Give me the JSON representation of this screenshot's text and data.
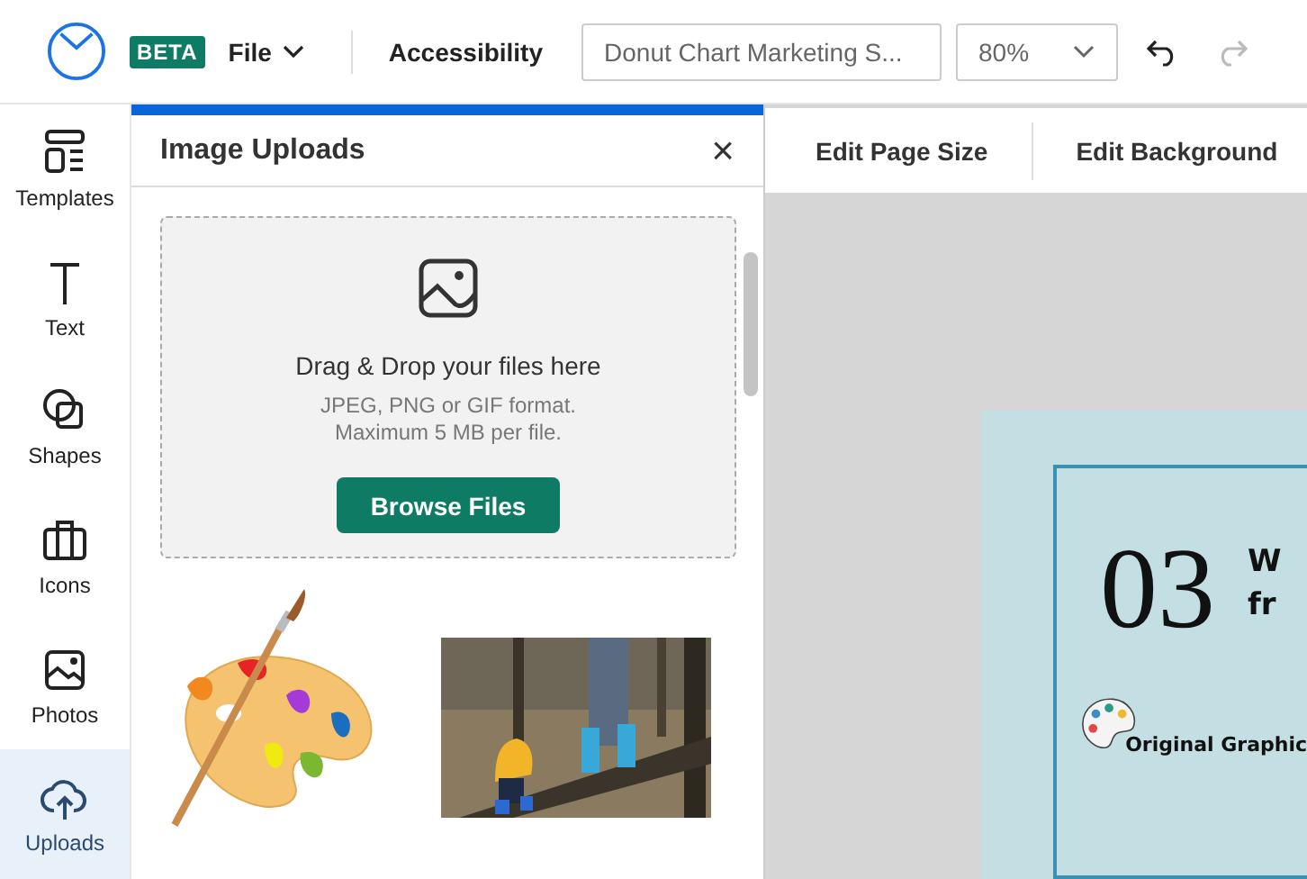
{
  "topbar": {
    "badge": "BETA",
    "file_menu": "File",
    "accessibility": "Accessibility",
    "document_title": "Donut Chart Marketing S...",
    "zoom": "80%"
  },
  "sidebar": {
    "items": [
      {
        "label": "Templates",
        "selected": false
      },
      {
        "label": "Text",
        "selected": false
      },
      {
        "label": "Shapes",
        "selected": false
      },
      {
        "label": "Icons",
        "selected": false
      },
      {
        "label": "Photos",
        "selected": false
      },
      {
        "label": "Uploads",
        "selected": true
      }
    ]
  },
  "panel": {
    "title": "Image Uploads",
    "close": "×",
    "dropzone": {
      "title": "Drag & Drop your files here",
      "hint_lines": [
        "JPEG, PNG or GIF format.",
        "Maximum 5 MB per file."
      ],
      "button": "Browse Files"
    },
    "uploads": [
      {
        "kind": "palette"
      },
      {
        "kind": "picture"
      }
    ]
  },
  "toolbar": {
    "buttons": [
      "Edit Page Size",
      "Edit Background"
    ]
  },
  "page": {
    "number": "03",
    "heading_lines": [
      "W",
      "fr"
    ],
    "badge_text": "Original Graphic"
  }
}
